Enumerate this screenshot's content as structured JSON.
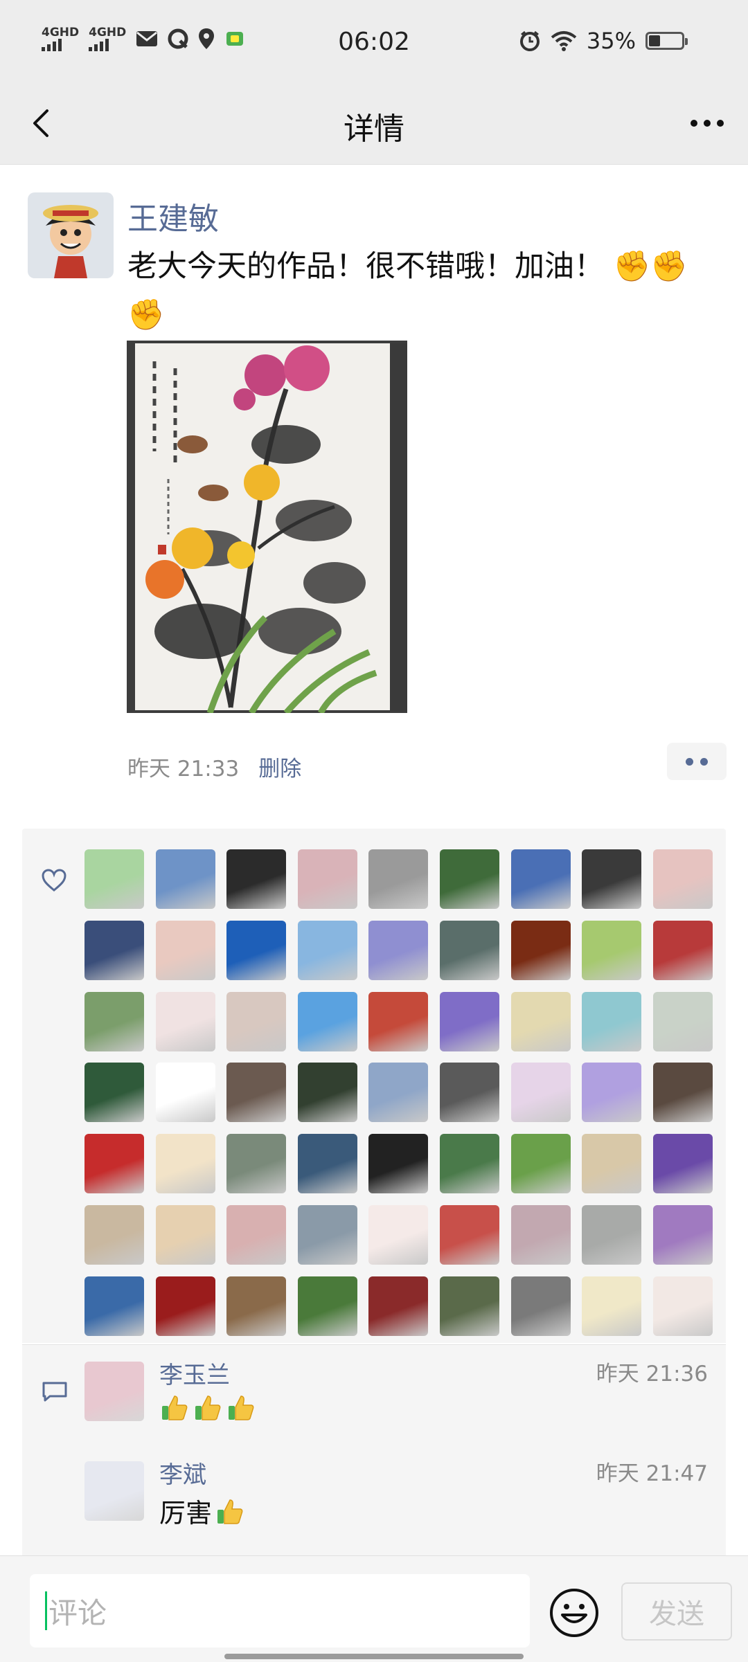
{
  "status_bar": {
    "signal1": "4GHD",
    "signal2": "4GHD",
    "time": "06:02",
    "battery_percent": "35%",
    "battery_level": 0.35,
    "icons": [
      "mail-icon",
      "app-icon",
      "location-icon",
      "game-icon",
      "alarm-icon",
      "wifi-icon"
    ]
  },
  "nav": {
    "title": "详情",
    "back_icon": "back-arrow-icon",
    "more_icon": "more-icon"
  },
  "post": {
    "author": "王建敏",
    "text": "老大今天的作品！很不错哦！加油！ ✊✊✊",
    "image_desc_icon": "chrysanthemum-painting",
    "time": "昨天 21:33",
    "delete_label": "删除"
  },
  "likes": {
    "icon": "heart-icon",
    "count": 63,
    "avatar_colors": [
      "#a9d5a0",
      "#6e93c7",
      "#2b2b2b",
      "#d9b3b8",
      "#9a9a9a",
      "#3f6b3a",
      "#4a6fb5",
      "#3a3a3a",
      "#e6c3c0",
      "#3a4e7a",
      "#e9c9c0",
      "#1e5fb8",
      "#88b6e0",
      "#8f8fd1",
      "#5a6e6a",
      "#7a2c14",
      "#a6c96f",
      "#b83a3a",
      "#7b9e6b",
      "#f0e2e2",
      "#d8c8c0",
      "#5aa2e0",
      "#c54a3a",
      "#7f6dc7",
      "#e3d9b0",
      "#8fc8d0",
      "#c9d2c8",
      "#2f5a3a",
      "#ffffff",
      "#6b5a50",
      "#324030",
      "#8fa6c8",
      "#5a5a5a",
      "#e6d4e8",
      "#b0a0e0",
      "#5a4a40",
      "#c62c2c",
      "#f2e3c8",
      "#7a8a7a",
      "#3a5a7a",
      "#222222",
      "#4a7a4a",
      "#6aa04a",
      "#d8c8a8",
      "#6a4aa8",
      "#c9b8a0",
      "#e6d0b0",
      "#d8b0b0",
      "#8a9aa8",
      "#f5eae8",
      "#c8504a",
      "#c2a8b0",
      "#a8aaa8",
      "#a07ac0",
      "#3a6aa8",
      "#9a1c1c",
      "#8a6a4a",
      "#4a7a3a",
      "#8a2a2a",
      "#5a6a4a",
      "#7a7a7a",
      "#f0e8c8",
      "#f2e8e4"
    ]
  },
  "comments": {
    "icon": "comment-icon",
    "items": [
      {
        "name": "李玉兰",
        "time": "昨天 21:36",
        "text": "",
        "thumbs": 3,
        "avatar_color": "#e8c8d0"
      },
      {
        "name": "李斌",
        "time": "昨天 21:47",
        "text": "厉害",
        "thumbs": 1,
        "avatar_color": "#e6e8f0"
      }
    ]
  },
  "input": {
    "placeholder": "评论",
    "emoji_icon": "emoji-icon",
    "send_label": "发送"
  }
}
